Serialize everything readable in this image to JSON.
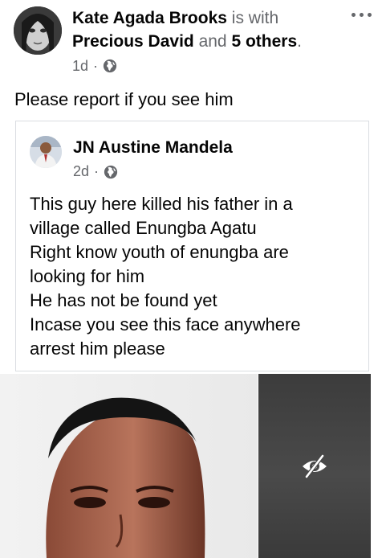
{
  "post": {
    "author": "Kate Agada Brooks",
    "with_text": "is with",
    "tagged_person": "Precious David",
    "and_text": "and",
    "others": "5 others",
    "period": ".",
    "time": "1d",
    "separator": "·",
    "privacy_icon": "globe-icon",
    "more_icon": "more-options-icon",
    "text": "Please report if you see him"
  },
  "shared": {
    "author": "JN Austine Mandela",
    "time": "2d",
    "separator": "·",
    "privacy_icon": "globe-icon",
    "lines": [
      "This guy here killed his father in a",
      "village called Enungba Agatu",
      "Right know youth of enungba are",
      "looking for  him",
      "He has not be found yet",
      "Incase you see this face anywhere",
      "arrest him please"
    ]
  },
  "media": {
    "hidden_icon": "eye-slash-icon"
  },
  "colors": {
    "text_primary": "#050505",
    "text_secondary": "#65676b",
    "border": "#dadde1"
  }
}
